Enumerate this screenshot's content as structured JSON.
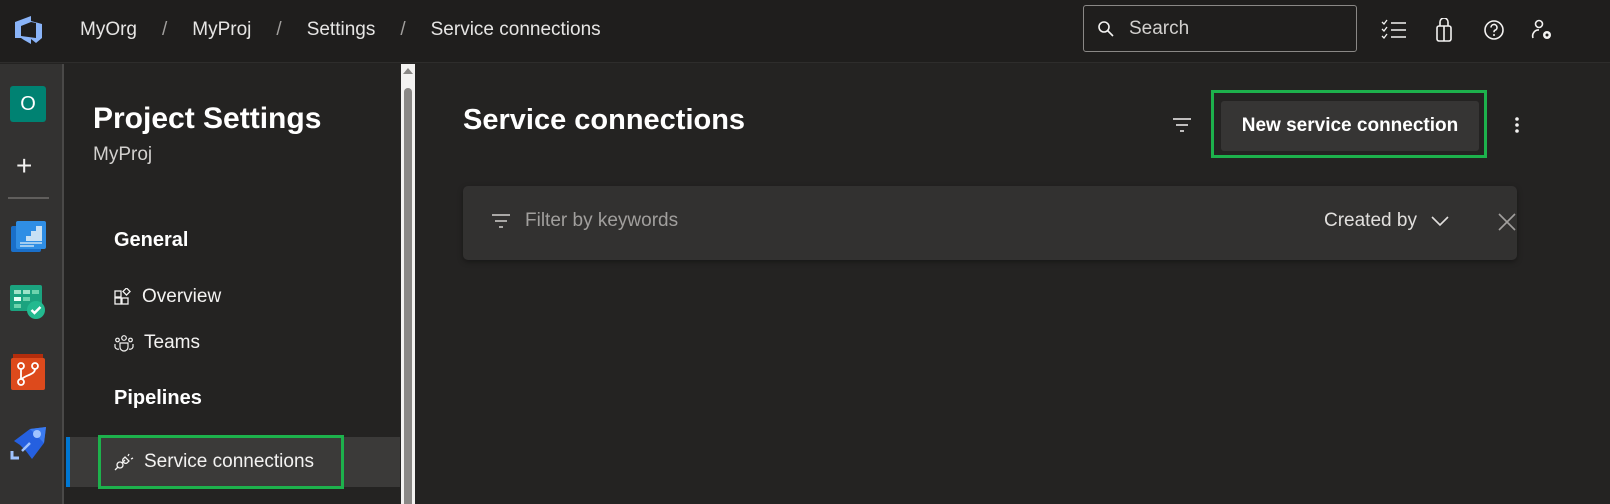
{
  "topbar": {
    "breadcrumbs": [
      "MyOrg",
      "MyProj",
      "Settings",
      "Service connections"
    ],
    "separator": "/",
    "search_placeholder": "Search",
    "icons": [
      "task-list-icon",
      "marketplace-bag-icon",
      "help-icon",
      "user-settings-icon"
    ]
  },
  "leftrail": {
    "org_initial": "O",
    "add_label": "+",
    "apps": [
      "overview",
      "boards",
      "repos",
      "pipelines"
    ]
  },
  "sidebar": {
    "title": "Project Settings",
    "subtitle": "MyProj",
    "sections": [
      {
        "heading": "General",
        "items": [
          {
            "label": "Overview",
            "icon": "overview-icon"
          },
          {
            "label": "Teams",
            "icon": "teams-icon"
          }
        ]
      },
      {
        "heading": "Pipelines",
        "items": [
          {
            "label": "Service connections",
            "icon": "plug-icon",
            "selected": true
          }
        ]
      }
    ]
  },
  "main": {
    "title": "Service connections",
    "new_button_label": "New service connection",
    "filter_placeholder": "Filter by keywords",
    "created_by_label": "Created by"
  },
  "colors": {
    "highlight_box": "#1db14c",
    "selected_indicator": "#0078d4",
    "org_avatar": "#008272"
  }
}
